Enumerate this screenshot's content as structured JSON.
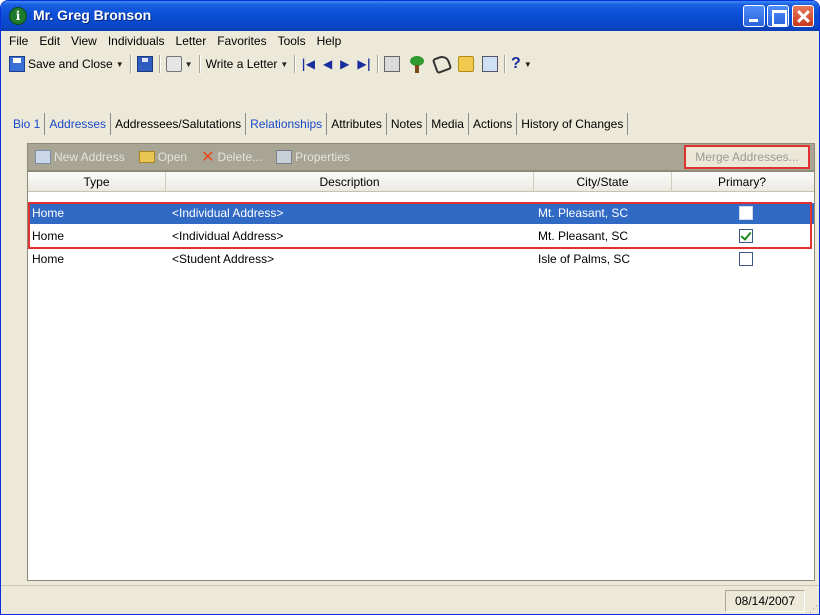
{
  "window": {
    "title": "Mr. Greg Bronson"
  },
  "menu": [
    "File",
    "Edit",
    "View",
    "Individuals",
    "Letter",
    "Favorites",
    "Tools",
    "Help"
  ],
  "toolbar": {
    "save_close": "Save and Close",
    "write_letter": "Write a Letter",
    "help": "?"
  },
  "tabs": [
    {
      "label": "Bio 1"
    },
    {
      "label": "Addresses"
    },
    {
      "label": "Addressees/Salutations"
    },
    {
      "label": "Relationships"
    },
    {
      "label": "Attributes"
    },
    {
      "label": "Notes"
    },
    {
      "label": "Media"
    },
    {
      "label": "Actions"
    },
    {
      "label": "History of Changes"
    }
  ],
  "actions": {
    "new_address": "New Address",
    "open": "Open",
    "delete": "Delete...",
    "properties": "Properties",
    "merge": "Merge Addresses..."
  },
  "grid": {
    "headers": [
      "Type",
      "Description",
      "City/State",
      "Primary?"
    ],
    "rows": [
      {
        "type": "Home",
        "description": "<Individual Address>",
        "city_state": "Mt. Pleasant, SC",
        "primary": false,
        "selected": true
      },
      {
        "type": "Home",
        "description": "<Individual Address>",
        "city_state": "Mt. Pleasant, SC",
        "primary": true,
        "selected": false
      },
      {
        "type": "Home",
        "description": "<Student Address>",
        "city_state": "Isle of Palms, SC",
        "primary": false,
        "selected": false
      }
    ]
  },
  "status": {
    "date": "08/14/2007"
  },
  "colors": {
    "title_bar": "#0a4fd6",
    "selection": "#316ac5",
    "highlight_box": "#e03030"
  }
}
